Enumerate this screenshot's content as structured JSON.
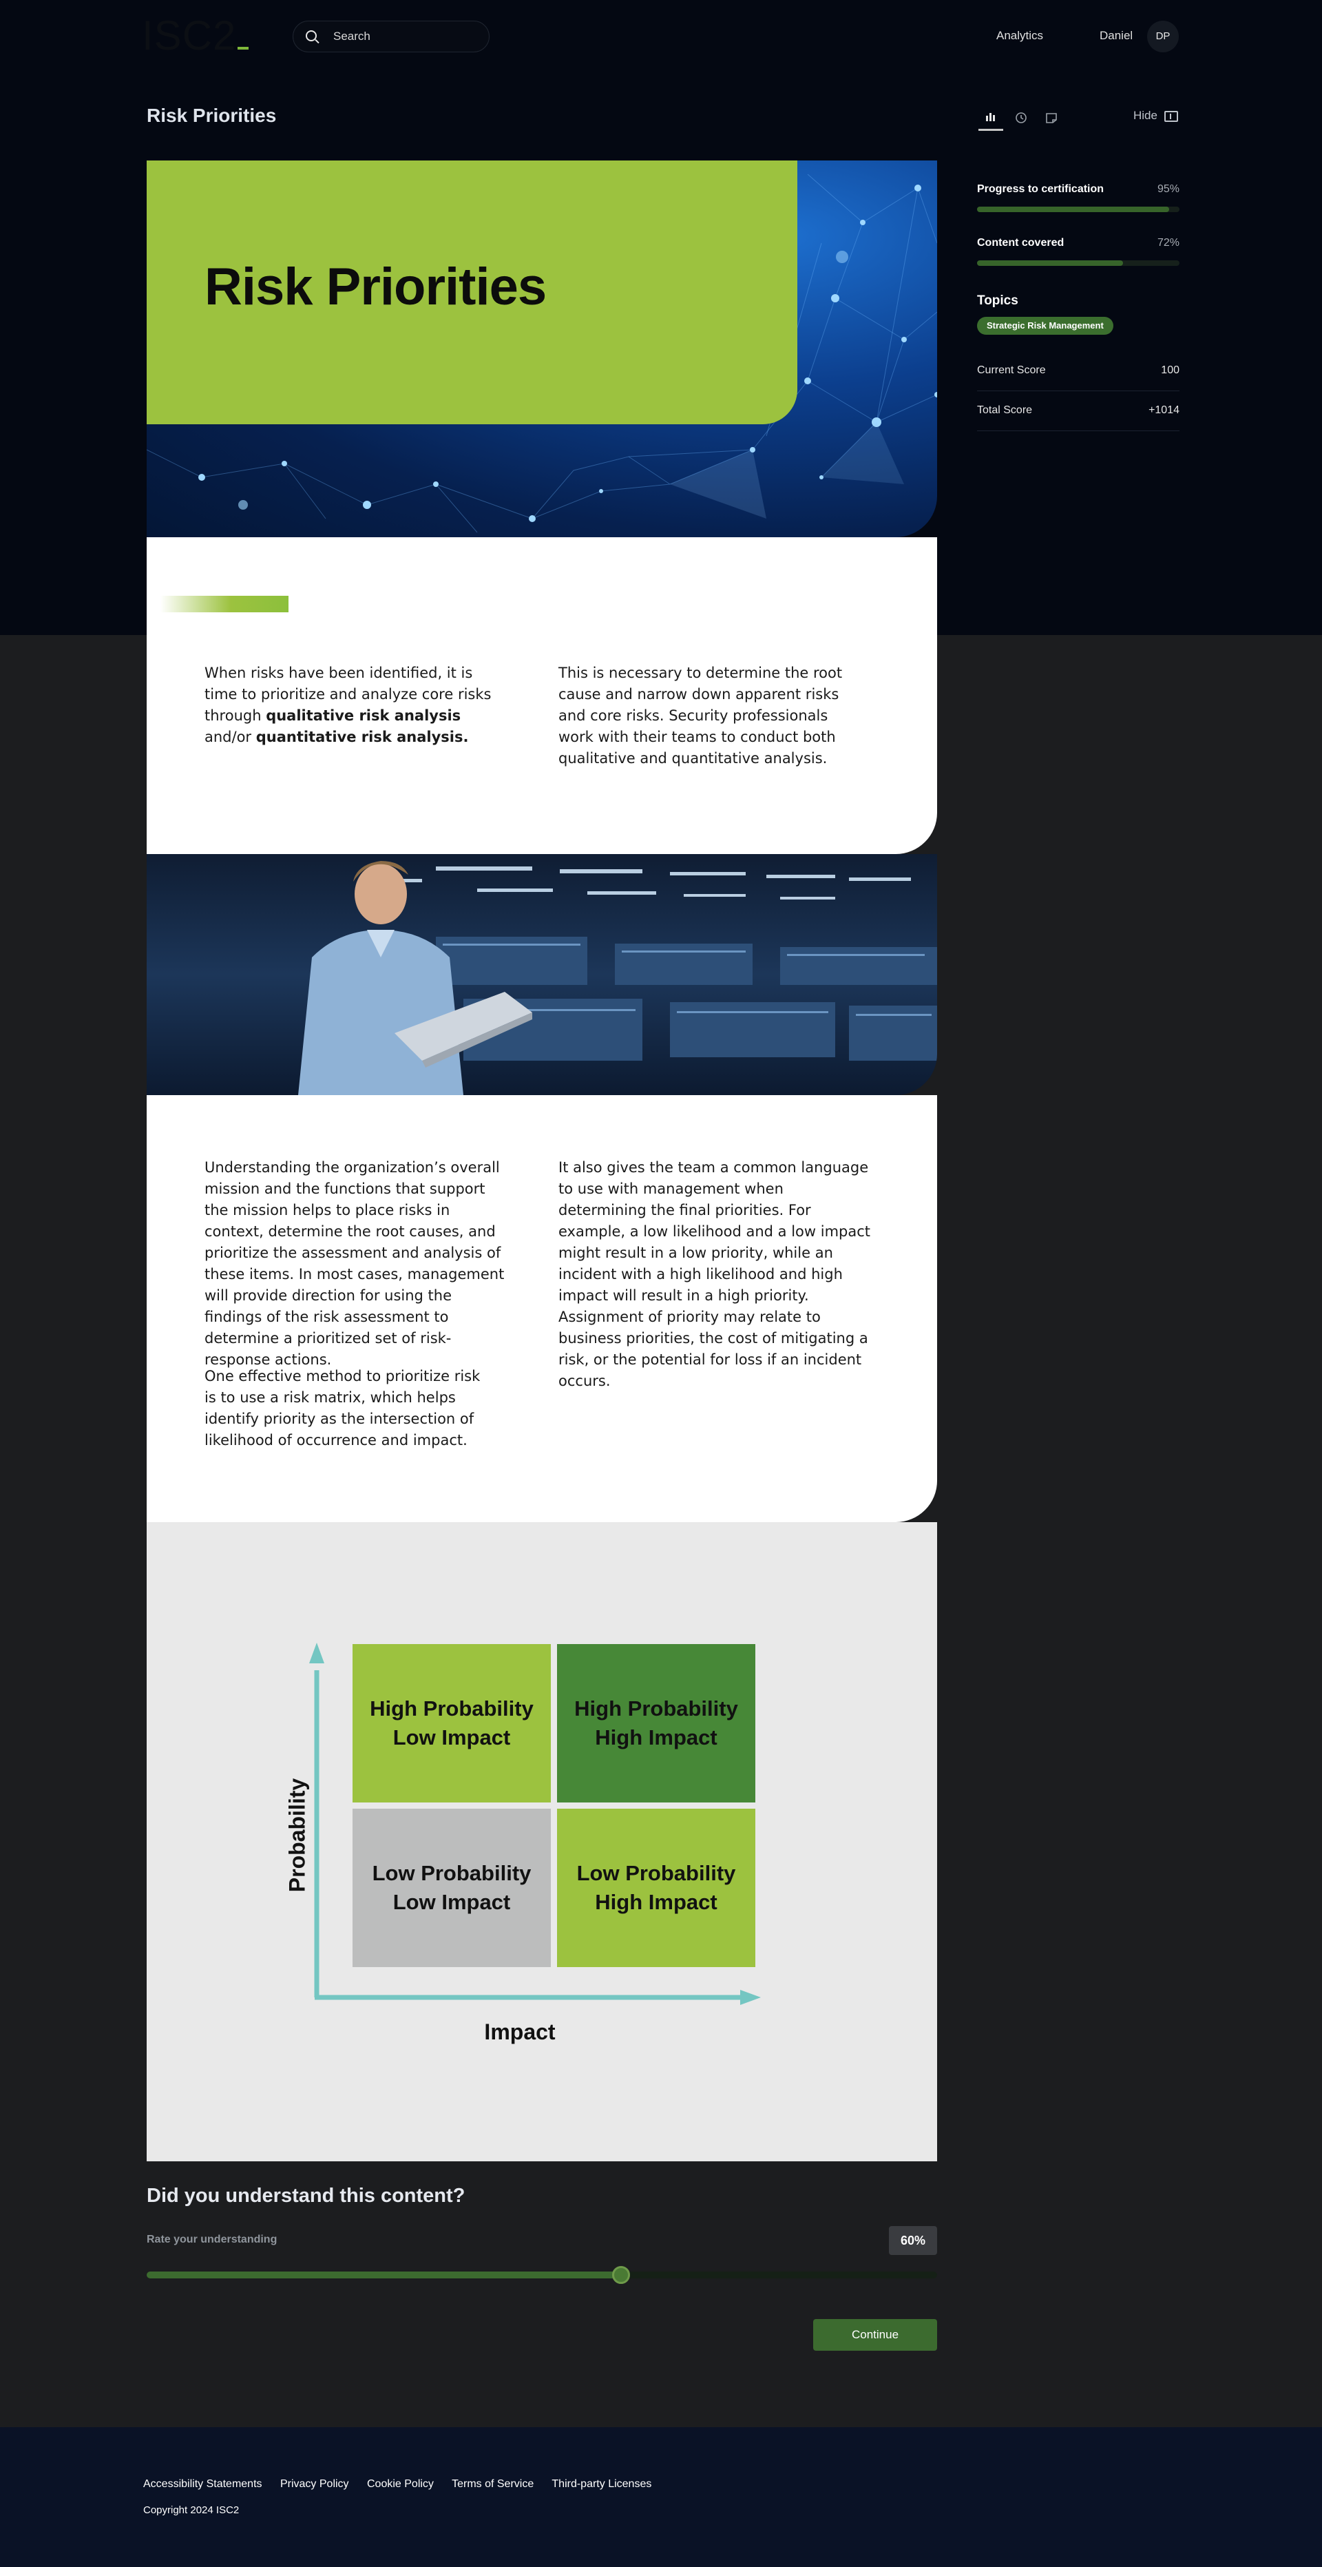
{
  "header": {
    "logo": "ISC2",
    "search_placeholder": "Search",
    "analytics": "Analytics",
    "user_name": "Daniel",
    "user_initials": "DP"
  },
  "page": {
    "title": "Risk Priorities",
    "hide_label": "Hide"
  },
  "sidebar": {
    "progress": [
      {
        "label": "Progress to certification",
        "value": "95%",
        "fraction": 0.95
      },
      {
        "label": "Content covered",
        "value": "72%",
        "fraction": 0.72
      }
    ],
    "topics_title": "Topics",
    "topic": "Strategic Risk Management",
    "scores": [
      {
        "label": "Current Score",
        "value": "100"
      },
      {
        "label": "Total Score",
        "value": "+1014"
      }
    ]
  },
  "hero": {
    "title": "Risk Priorities"
  },
  "section1": {
    "left_a": "When risks have been identified, it is time to prioritize and analyze core risks through ",
    "left_b": "qualitative risk analysis",
    "left_c": " and/or ",
    "left_d": "quantitative risk analysis.",
    "right": "This is necessary to determine the root cause and narrow down apparent risks and core risks. Security professionals work with their teams to conduct both qualitative and quantitative analysis."
  },
  "section2": {
    "left_p1": "Understanding the organization’s overall mission and the functions that support the mission helps to place risks in context, determine the root causes, and prioritize the assessment and analysis of these items. In most cases, management will provide direction for using the findings of the risk assessment to determine a prioritized set of risk-response actions.",
    "left_p2": "One effective method to prioritize risk is to use a risk matrix, which helps identify priority as the intersection of likelihood of occurrence and impact.",
    "right": "It also gives the team a common language to use with management when determining the final priorities. For example, a low likelihood and a low impact might result in a low priority, while an incident with a high likelihood and high impact will result in a high priority. Assignment of priority may relate to business priorities, the cost of mitigating a risk, or the potential for loss if an incident occurs."
  },
  "matrix": {
    "cells": [
      {
        "line1": "High Probability",
        "line2": "Low Impact",
        "color": "#9cc23f"
      },
      {
        "line1": "High Probability",
        "line2": "High Impact",
        "color": "#478837"
      },
      {
        "line1": "Low Probability",
        "line2": "Low Impact",
        "color": "#bcbdbd"
      },
      {
        "line1": "Low Probability",
        "line2": "High Impact",
        "color": "#9cc23f"
      }
    ],
    "y_label": "Probability",
    "x_label": "Impact",
    "axis_color": "#74c6c2"
  },
  "understanding": {
    "question": "Did you understand this content?",
    "rate_label": "Rate your understanding",
    "value_label": "60%",
    "fraction": 0.6,
    "continue": "Continue"
  },
  "footer": {
    "links": [
      "Accessibility Statements",
      "Privacy Policy",
      "Cookie Policy",
      "Terms of Service",
      "Third-party Licenses"
    ],
    "copyright": "Copyright 2024 ISC2"
  }
}
